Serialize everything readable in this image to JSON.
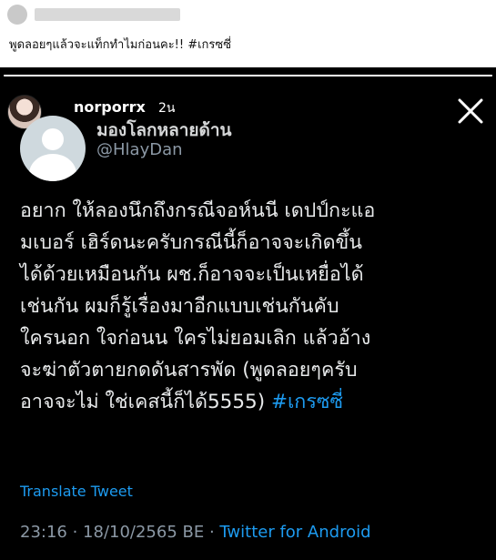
{
  "post": {
    "caption": "พูดลอยๆแล้วจะแท็กทำไมก่อนคะ!! #เกรซซี่"
  },
  "story": {
    "username": "norporrx",
    "time_ago": "2น",
    "close_icon": "close-icon"
  },
  "tweet": {
    "display_name": "มองโลกหลายด้าน",
    "handle": "@HlayDan",
    "text_lines": [
      "อยาก ให้ลองนึกถึงกรณีจอห์นนี เดปป์กะแอ",
      "มเบอร์ เฮิร์ดนะครับกรณีนี้ก็อาจจะเกิดขึ้น",
      "ได้ด้วยเหมือนกัน ผช.ก็อาจจะเป็นเหยื่อได้",
      "เช่นกัน ผมก็รู้เรื่องมาอีกแบบเช่นกันคับ",
      "ใครนอก ใจก่อนน ใครไม่ยอมเลิก แล้วอ้าง",
      "จะฆ่าตัวตายกดดันสารพัด (พูดลอยๆครับ",
      "อาจจะไม่ ใช่เคสนี้ก็ได้5555)"
    ],
    "hashtag": "#เกรซซี่",
    "translate_label": "Translate Tweet",
    "timestamp": "23:16 · 18/10/2565 BE · ",
    "source": "Twitter for Android"
  },
  "colors": {
    "story_bg": "#000000",
    "tweet_text": "#e7e9ea",
    "link_blue": "#1d9bf0",
    "muted_gray": "#8b98a5"
  }
}
